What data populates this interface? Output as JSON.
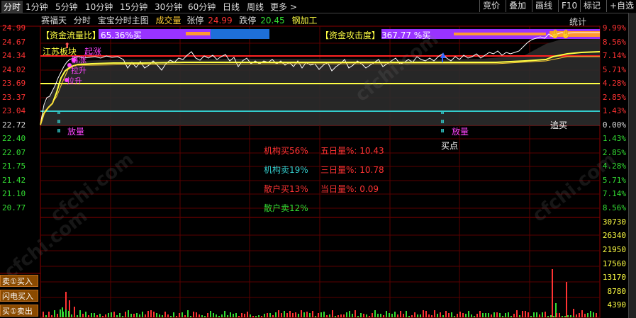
{
  "tabs": [
    "分时",
    "1分钟",
    "5分钟",
    "10分钟",
    "15分钟",
    "30分钟",
    "60分钟",
    "日线",
    "周线",
    "更多 >"
  ],
  "right_buttons": [
    "竞价",
    "叠加",
    "画线",
    "F10",
    "+自选"
  ],
  "header": {
    "stock_name": "赛福天",
    "period": "分时",
    "chart_name": "宝宝分时主图",
    "volume_label": "成交量",
    "limit_up_label": "张停",
    "limit_up_value": "24.99",
    "limit_down_label": "跌停",
    "limit_down_value": "20.45",
    "sector": "钢加工",
    "stats_label": "统计",
    "mark_label": "标记"
  },
  "indicator_left": {
    "label": "【资金流量比】",
    "value": "65.36%买"
  },
  "indicator_right": {
    "label": "【资金攻击度】",
    "value": "367.77 %买"
  },
  "price_left": [
    "24.99",
    "24.67",
    "24.34",
    "24.02",
    "23.69",
    "23.37",
    "23.04",
    "22.72",
    "22.40",
    "22.07",
    "21.75",
    "21.42",
    "21.10",
    "20.77"
  ],
  "price_right": [
    "9.99%",
    "8.56%",
    "7.14%",
    "5.71%",
    "4.28%",
    "2.85%",
    "1.43%",
    "0.00%",
    "1.43%",
    "2.85%",
    "4.28%",
    "5.71%",
    "7.14%",
    "8.56%"
  ],
  "vol_right": [
    "30730",
    "26340",
    "21950",
    "17560",
    "13170",
    "8780",
    "4390"
  ],
  "side_buttons": [
    "卖①买入",
    "闪电买入",
    "买①卖出"
  ],
  "annotations": {
    "jiangsu": "江苏板块",
    "qizhang": "起涨",
    "baozhang": "暴涨",
    "lasheng": "拉升",
    "kaisheng": "拉升",
    "fangliang1": "放量",
    "fangliang2": "放量",
    "maidian": "买点",
    "zhuimai": "追买"
  },
  "stats": {
    "inst_buy": "机构买56%",
    "inst_sell": "机构卖19%",
    "retail_buy": "散户买13%",
    "retail_sell": "散户卖12%",
    "vol5": "五日量%: 10.43",
    "vol3": "三日量%: 10.78",
    "vol_today": "当日量%: 0.09"
  },
  "watermark": "cfchi.com",
  "colors": {
    "up": "#ff3333",
    "down": "#33dd33",
    "yellow": "#ffff44",
    "cyan": "#33cccc",
    "magenta": "#ff44ff",
    "purple": "#9933ff"
  }
}
